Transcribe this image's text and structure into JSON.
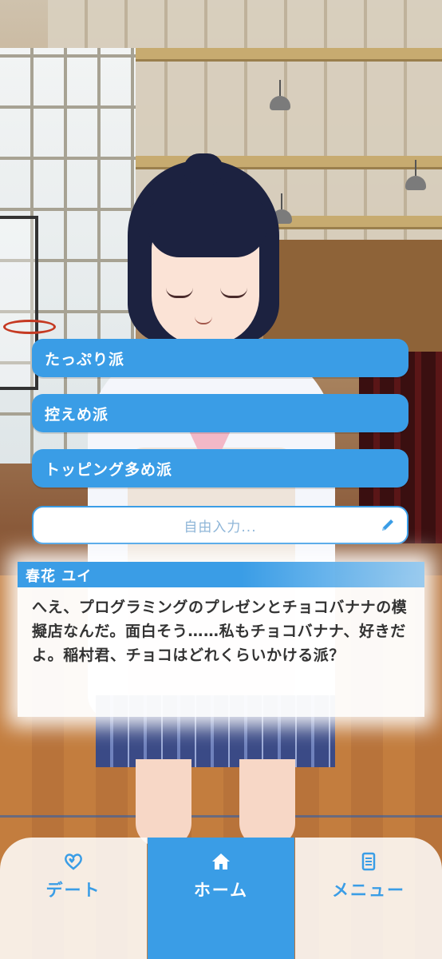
{
  "choices": [
    {
      "label": "たっぷり派"
    },
    {
      "label": "控えめ派"
    },
    {
      "label": "トッピング多め派"
    }
  ],
  "free_input": {
    "placeholder": "自由入力..."
  },
  "dialog": {
    "speaker": "春花 ユイ",
    "text": "へえ、プログラミングのプレゼンとチョコバナナの模擬店なんだ。面白そう……私もチョコバナナ、好きだよ。稲村君、チョコはどれくらいかける派？"
  },
  "nav": {
    "items": [
      {
        "label": "デート",
        "icon": "heart-icon",
        "active": false
      },
      {
        "label": "ホーム",
        "icon": "home-icon",
        "active": true
      },
      {
        "label": "メニュー",
        "icon": "menu-list-icon",
        "active": false
      }
    ]
  },
  "colors": {
    "accent": "#3a9de6",
    "text": "#333333",
    "background_panel": "#ffffff"
  }
}
